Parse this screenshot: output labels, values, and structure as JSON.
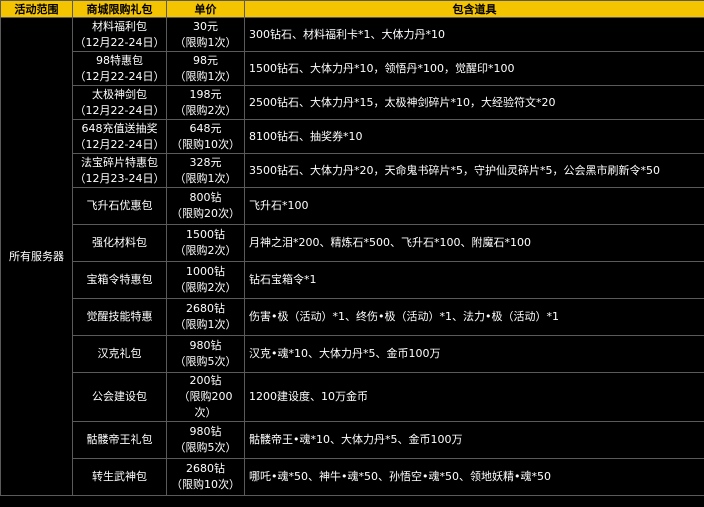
{
  "headers": {
    "scope": "活动范围",
    "pack": "商城限购礼包",
    "price": "单价",
    "contents": "包含道具"
  },
  "scope_value": "所有服务器",
  "rows": [
    {
      "pack": [
        "材料福利包",
        "（12月22-24日）"
      ],
      "price": [
        "30元",
        "（限购1次）"
      ],
      "contents": "300钻石、材料福利卡*1、大体力丹*10"
    },
    {
      "pack": [
        "98特惠包",
        "（12月22-24日）"
      ],
      "price": [
        "98元",
        "（限购1次）"
      ],
      "contents": "1500钻石、大体力丹*10，领悟丹*100，觉醒印*100"
    },
    {
      "pack": [
        "太极神剑包",
        "（12月22-24日）"
      ],
      "price": [
        "198元",
        "（限购2次）"
      ],
      "contents": "2500钻石、大体力丹*15，太极神剑碎片*10，大经验符文*20"
    },
    {
      "pack": [
        "648充值送抽奖",
        "（12月22-24日）"
      ],
      "price": [
        "648元",
        "（限购10次）"
      ],
      "contents": "8100钻石、抽奖券*10"
    },
    {
      "pack": [
        "法宝碎片特惠包",
        "（12月23-24日）"
      ],
      "price": [
        "328元",
        "（限购1次）"
      ],
      "contents": "3500钻石、大体力丹*20，天命鬼书碎片*5，守护仙灵碎片*5，公会黑市刷新令*50"
    },
    {
      "pack": [
        "飞升石优惠包"
      ],
      "price": [
        "800钻",
        "（限购20次）"
      ],
      "contents": "飞升石*100"
    },
    {
      "pack": [
        "强化材料包"
      ],
      "price": [
        "1500钻",
        "（限购2次）"
      ],
      "contents": "月神之泪*200、精炼石*500、飞升石*100、附魔石*100"
    },
    {
      "pack": [
        "宝箱令特惠包"
      ],
      "price": [
        "1000钻",
        "（限购2次）"
      ],
      "contents": "钻石宝箱令*1"
    },
    {
      "pack": [
        "觉醒技能特惠"
      ],
      "price": [
        "2680钻",
        "（限购1次）"
      ],
      "contents": "伤害•极（活动）*1、终伤•极（活动）*1、法力•极（活动）*1"
    },
    {
      "pack": [
        "汉克礼包"
      ],
      "price": [
        "980钻",
        "（限购5次）"
      ],
      "contents": "汉克•魂*10、大体力丹*5、金币100万"
    },
    {
      "pack": [
        "公会建设包"
      ],
      "price": [
        "200钻",
        "（限购200",
        "次）"
      ],
      "contents": "1200建设度、10万金币"
    },
    {
      "pack": [
        "骷髅帝王礼包"
      ],
      "price": [
        "980钻",
        "（限购5次）"
      ],
      "contents": "骷髅帝王•魂*10、大体力丹*5、金币100万"
    },
    {
      "pack": [
        "转生武神包"
      ],
      "price": [
        "2680钻",
        "（限购10次）"
      ],
      "contents": "哪吒•魂*50、神牛•魂*50、孙悟空•魂*50、领地妖精•魂*50"
    }
  ]
}
